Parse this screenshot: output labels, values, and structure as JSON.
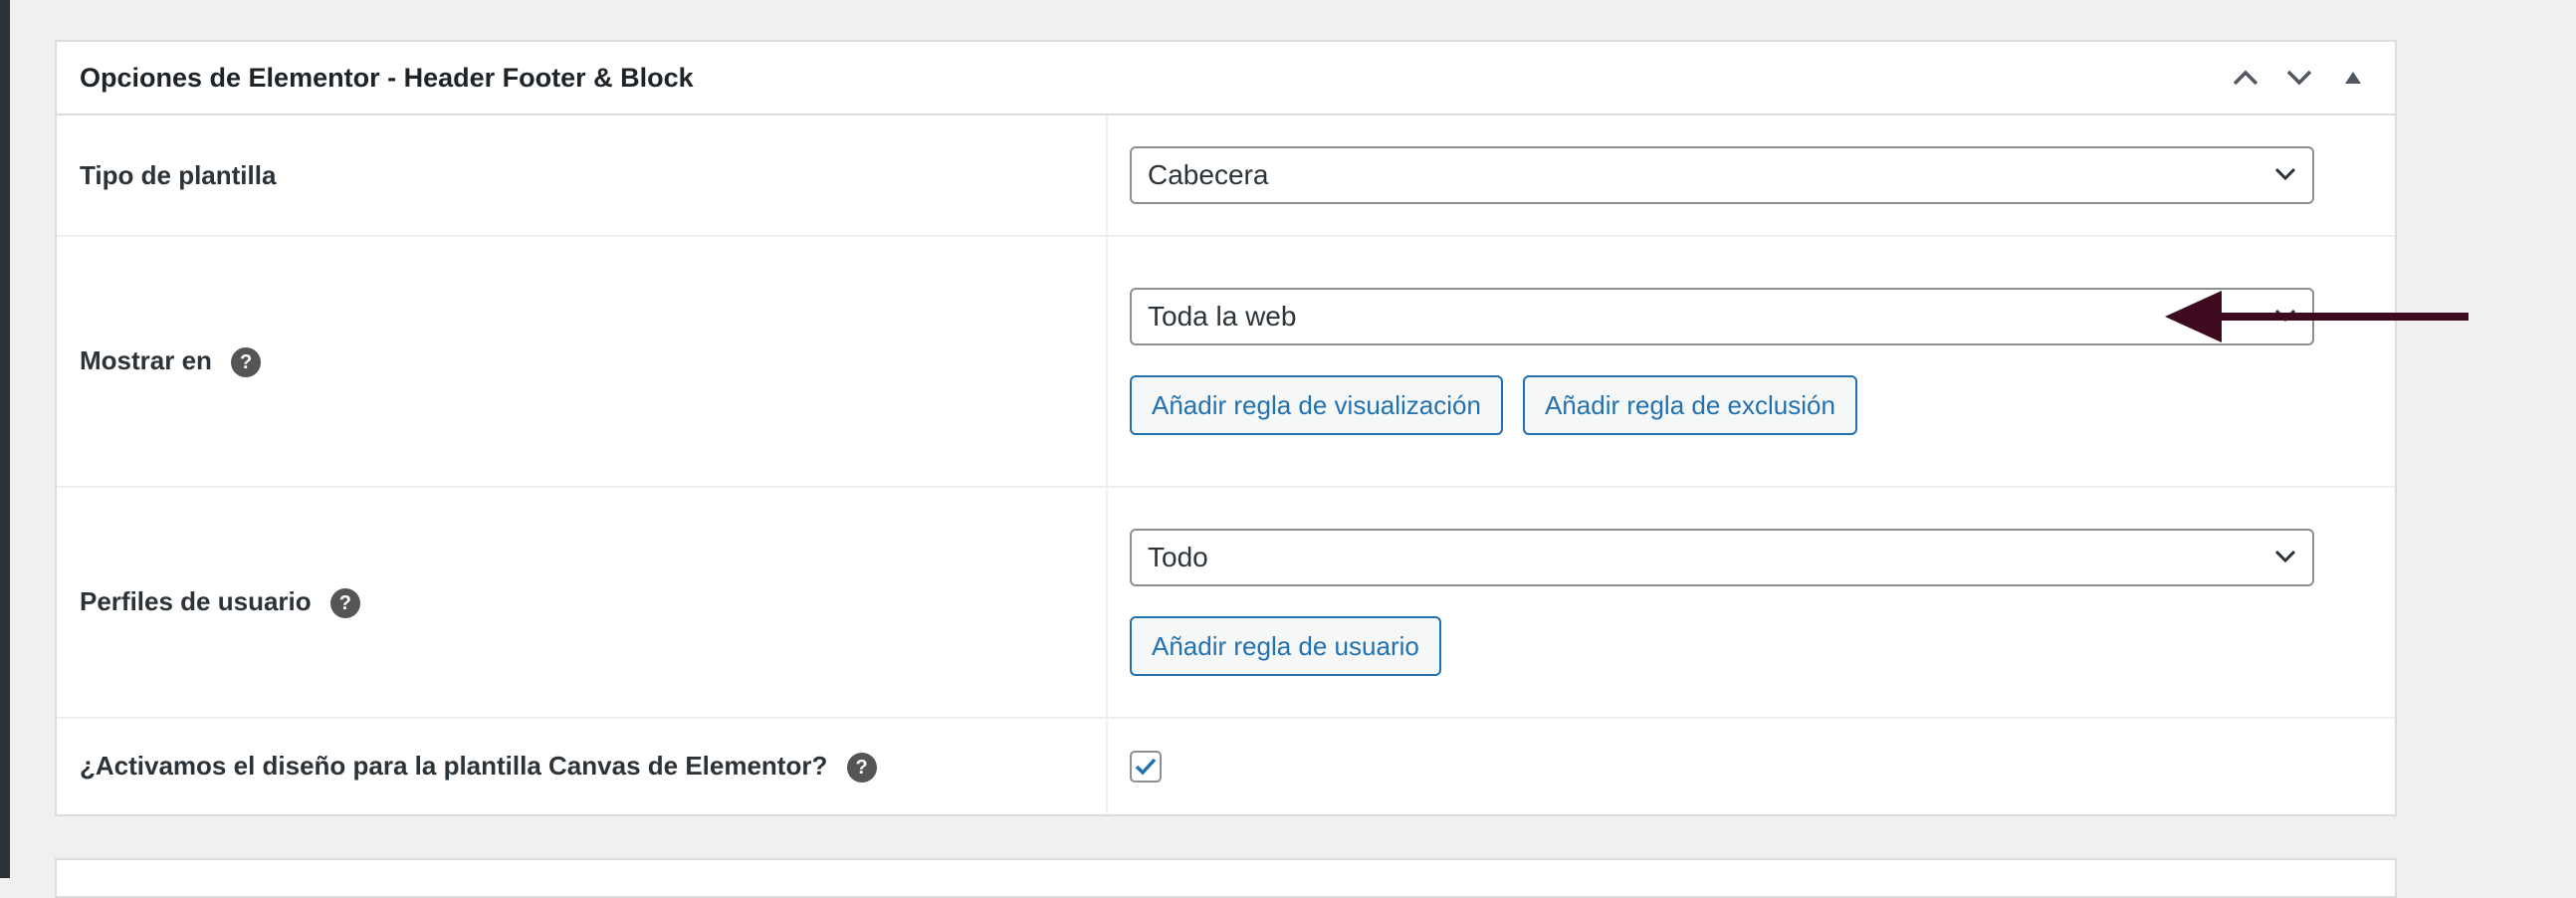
{
  "metabox": {
    "title": "Opciones de Elementor - Header Footer & Block",
    "actions": [
      "move-up-icon",
      "move-down-icon",
      "toggle-panel-icon"
    ]
  },
  "rows": {
    "template_type": {
      "label": "Tipo de plantilla",
      "value": "Cabecera"
    },
    "display_on": {
      "label": "Mostrar en",
      "value": "Toda la web",
      "add_display_rule": "Añadir regla de visualización",
      "add_exclusion_rule": "Añadir regla de exclusión"
    },
    "user_roles": {
      "label": "Perfiles de usuario",
      "value": "Todo",
      "add_user_rule": "Añadir regla de usuario"
    },
    "canvas": {
      "label": "¿Activamos el diseño para la plantilla Canvas de Elementor?",
      "checked": true
    }
  },
  "help_symbol": "?",
  "colors": {
    "accent": "#2271b1",
    "annotation_arrow": "#3d0a1f"
  }
}
